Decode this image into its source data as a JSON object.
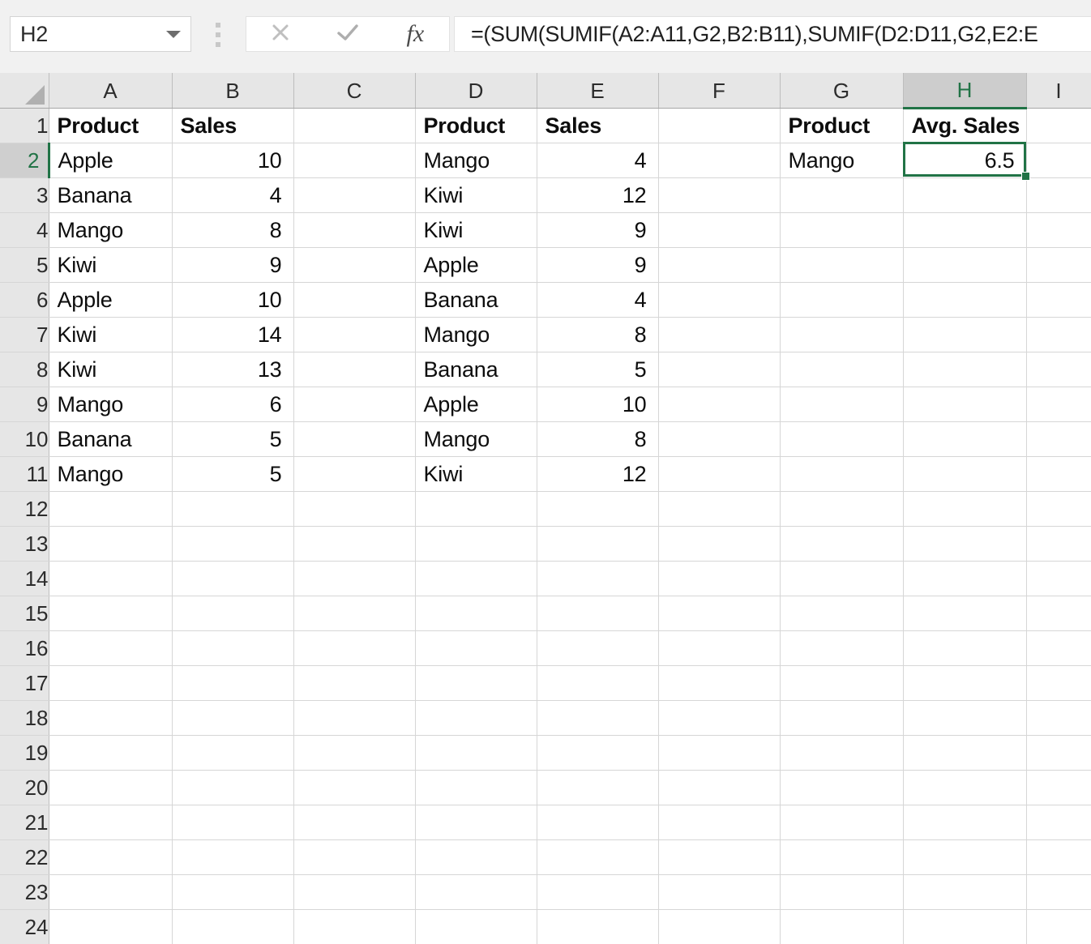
{
  "app": {
    "name_box_value": "H2",
    "formula": "=(SUM(SUMIF(A2:A11,G2,B2:B11),SUMIF(D2:D11,G2,E2:E",
    "cancel_icon": "close-icon",
    "enter_icon": "check-icon",
    "fx_icon": "fx-icon",
    "fx_label": "fx",
    "cancel_glyph": "✕",
    "check_glyph": "✓"
  },
  "grid": {
    "column_headers": [
      "A",
      "B",
      "C",
      "D",
      "E",
      "F",
      "G",
      "H",
      "I"
    ],
    "selected_column": "H",
    "selected_row": "2",
    "active_cell": "H2",
    "row_numbers": [
      "1",
      "2",
      "3",
      "4",
      "5",
      "6",
      "7",
      "8",
      "9",
      "10",
      "11",
      "12",
      "13",
      "14",
      "15",
      "16",
      "17",
      "18",
      "19",
      "20",
      "21",
      "22",
      "23",
      "24"
    ],
    "rows": [
      {
        "n": "1",
        "A": "Product",
        "B": "Sales",
        "C": "",
        "D": "Product",
        "E": "Sales",
        "F": "",
        "G": "Product",
        "H": "Avg. Sales",
        "I": "",
        "bold": true
      },
      {
        "n": "2",
        "A": "Apple",
        "B": "10",
        "C": "",
        "D": "Mango",
        "E": "4",
        "F": "",
        "G": "Mango",
        "H": "6.5",
        "I": ""
      },
      {
        "n": "3",
        "A": "Banana",
        "B": "4",
        "C": "",
        "D": "Kiwi",
        "E": "12",
        "F": "",
        "G": "",
        "H": "",
        "I": ""
      },
      {
        "n": "4",
        "A": "Mango",
        "B": "8",
        "C": "",
        "D": "Kiwi",
        "E": "9",
        "F": "",
        "G": "",
        "H": "",
        "I": ""
      },
      {
        "n": "5",
        "A": "Kiwi",
        "B": "9",
        "C": "",
        "D": "Apple",
        "E": "9",
        "F": "",
        "G": "",
        "H": "",
        "I": ""
      },
      {
        "n": "6",
        "A": "Apple",
        "B": "10",
        "C": "",
        "D": "Banana",
        "E": "4",
        "F": "",
        "G": "",
        "H": "",
        "I": ""
      },
      {
        "n": "7",
        "A": "Kiwi",
        "B": "14",
        "C": "",
        "D": "Mango",
        "E": "8",
        "F": "",
        "G": "",
        "H": "",
        "I": ""
      },
      {
        "n": "8",
        "A": "Kiwi",
        "B": "13",
        "C": "",
        "D": "Banana",
        "E": "5",
        "F": "",
        "G": "",
        "H": "",
        "I": ""
      },
      {
        "n": "9",
        "A": "Mango",
        "B": "6",
        "C": "",
        "D": "Apple",
        "E": "10",
        "F": "",
        "G": "",
        "H": "",
        "I": ""
      },
      {
        "n": "10",
        "A": "Banana",
        "B": "5",
        "C": "",
        "D": "Mango",
        "E": "8",
        "F": "",
        "G": "",
        "H": "",
        "I": ""
      },
      {
        "n": "11",
        "A": "Mango",
        "B": "5",
        "C": "",
        "D": "Kiwi",
        "E": "12",
        "F": "",
        "G": "",
        "H": "",
        "I": ""
      },
      {
        "n": "12",
        "A": "",
        "B": "",
        "C": "",
        "D": "",
        "E": "",
        "F": "",
        "G": "",
        "H": "",
        "I": ""
      },
      {
        "n": "13",
        "A": "",
        "B": "",
        "C": "",
        "D": "",
        "E": "",
        "F": "",
        "G": "",
        "H": "",
        "I": ""
      },
      {
        "n": "14",
        "A": "",
        "B": "",
        "C": "",
        "D": "",
        "E": "",
        "F": "",
        "G": "",
        "H": "",
        "I": ""
      },
      {
        "n": "15",
        "A": "",
        "B": "",
        "C": "",
        "D": "",
        "E": "",
        "F": "",
        "G": "",
        "H": "",
        "I": ""
      },
      {
        "n": "16",
        "A": "",
        "B": "",
        "C": "",
        "D": "",
        "E": "",
        "F": "",
        "G": "",
        "H": "",
        "I": ""
      },
      {
        "n": "17",
        "A": "",
        "B": "",
        "C": "",
        "D": "",
        "E": "",
        "F": "",
        "G": "",
        "H": "",
        "I": ""
      },
      {
        "n": "18",
        "A": "",
        "B": "",
        "C": "",
        "D": "",
        "E": "",
        "F": "",
        "G": "",
        "H": "",
        "I": ""
      },
      {
        "n": "19",
        "A": "",
        "B": "",
        "C": "",
        "D": "",
        "E": "",
        "F": "",
        "G": "",
        "H": "",
        "I": ""
      },
      {
        "n": "20",
        "A": "",
        "B": "",
        "C": "",
        "D": "",
        "E": "",
        "F": "",
        "G": "",
        "H": "",
        "I": ""
      },
      {
        "n": "21",
        "A": "",
        "B": "",
        "C": "",
        "D": "",
        "E": "",
        "F": "",
        "G": "",
        "H": "",
        "I": ""
      },
      {
        "n": "22",
        "A": "",
        "B": "",
        "C": "",
        "D": "",
        "E": "",
        "F": "",
        "G": "",
        "H": "",
        "I": ""
      },
      {
        "n": "23",
        "A": "",
        "B": "",
        "C": "",
        "D": "",
        "E": "",
        "F": "",
        "G": "",
        "H": "",
        "I": ""
      },
      {
        "n": "24",
        "A": "",
        "B": "",
        "C": "",
        "D": "",
        "E": "",
        "F": "",
        "G": "",
        "H": "",
        "I": ""
      }
    ]
  },
  "colors": {
    "accent_green": "#217346",
    "header_gray": "#e6e6e6",
    "selected_header_gray": "#cdcdcd",
    "gridline": "#d6d6d6",
    "toolbar_bg": "#f1f1f1"
  }
}
